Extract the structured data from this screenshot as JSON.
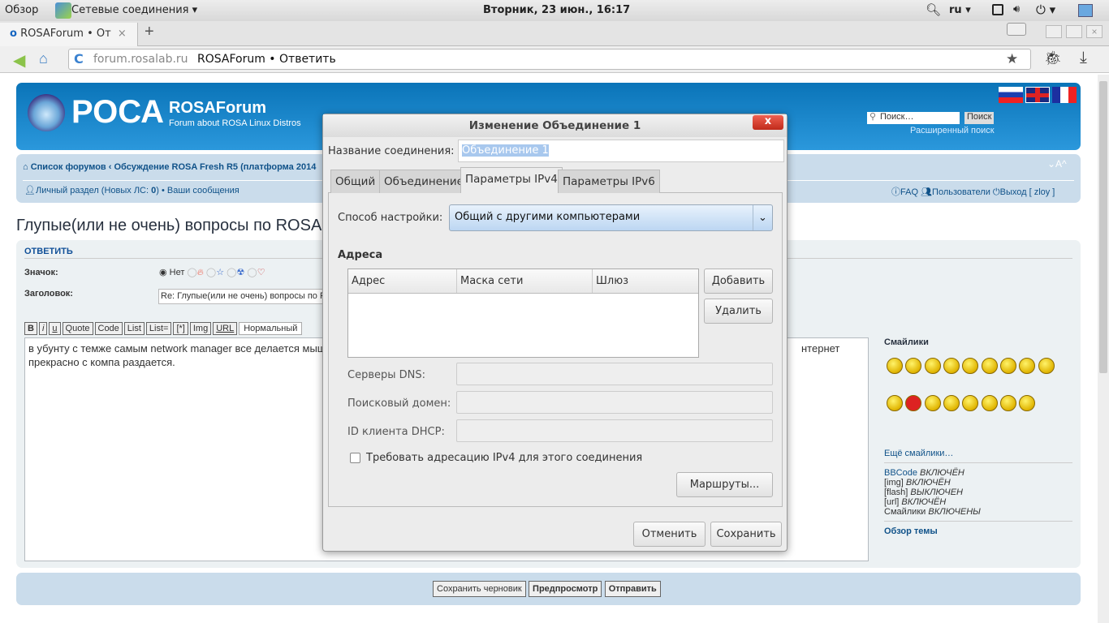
{
  "system_bar": {
    "overview": "Обзор",
    "app": "Сетевые соединения ▾",
    "clock": "Вторник, 23 июн., 16:17",
    "lang": "ru ▾"
  },
  "browser": {
    "tab_title": "ROSAForum • От",
    "tab_close": "×",
    "new_tab": "+",
    "url_domain": "forum.rosalab.ru",
    "url_title": "ROSAForum • Ответить"
  },
  "forum": {
    "site_title": "ROSAForum",
    "site_desc": "Forum about ROSA Linux Distros",
    "logo_text": "РОСА",
    "search_placeholder": "Поиск…",
    "search_button": "Поиск",
    "advanced_search": "Расширенный поиск",
    "breadcrumb": [
      "Список форумов",
      "Обсуждение ROSA Fresh R5 (платформа 2014"
    ],
    "breadcrumb_sep": "‹",
    "personal": "Личный раздел (Новых ЛС: ",
    "personal_count": "0",
    "personal_end": ")",
    "bullet": " • ",
    "messages": "Ваши сообщения",
    "font_ctrl": "⌄A^",
    "faq": "FAQ",
    "users": "Пользователи",
    "logout": "Выход [ zloy ]",
    "topic_title": "Глупые(или не очень) вопросы по ROSA",
    "reply_header": "ОТВЕТИТЬ",
    "icon_label": "Значок:",
    "icon_none": "Нет",
    "subject_label": "Заголовок:",
    "subject_value": "Re: Глупые(или не очень) вопросы по R",
    "bbcode_buttons": [
      "B",
      "i",
      "u",
      "Quote",
      "Code",
      "List",
      "List=",
      "[*]",
      "Img",
      "URL"
    ],
    "font_size": "Нормальный",
    "message_line1": "в убунту с темже самым network manager все делается мыш",
    "message_line1_end": "нтернет",
    "message_line2": "прекрасно с компа раздается.",
    "smilies_title": "Смайлики",
    "more_smilies": "Ещё смайлики…",
    "status": [
      {
        "k": "BBCode",
        "v": "ВКЛЮЧЁН"
      },
      {
        "k": "[img]",
        "v": "ВКЛЮЧЁН"
      },
      {
        "k": "[flash]",
        "v": "ВЫКЛЮЧЕН"
      },
      {
        "k": "[url]",
        "v": "ВКЛЮЧЁН"
      },
      {
        "k": "Смайлики",
        "v": "ВКЛЮЧЕНЫ"
      }
    ],
    "topic_review": "Обзор темы",
    "save_draft": "Сохранить черновик",
    "preview": "Предпросмотр",
    "submit": "Отправить"
  },
  "dialog": {
    "title": "Изменение Объединение 1",
    "close": "x",
    "name_label": "Название соединения:",
    "name_value": "Объединение 1",
    "tabs": [
      "Общий",
      "Объединение",
      "Параметры IPv4",
      "Параметры IPv6"
    ],
    "active_tab": 2,
    "method_label": "Способ настройки:",
    "method_value": "Общий с другими компьютерами",
    "addresses_label": "Адреса",
    "columns": [
      "Адрес",
      "Маска сети",
      "Шлюз"
    ],
    "add": "Добавить",
    "delete": "Удалить",
    "dns_label": "Серверы DNS:",
    "domain_label": "Поисковый домен:",
    "dhcp_label": "ID клиента DHCP:",
    "require_ipv4": "Требовать адресацию IPv4 для этого соединения",
    "require_checked": false,
    "routes": "Маршруты...",
    "cancel": "Отменить",
    "save": "Сохранить"
  }
}
